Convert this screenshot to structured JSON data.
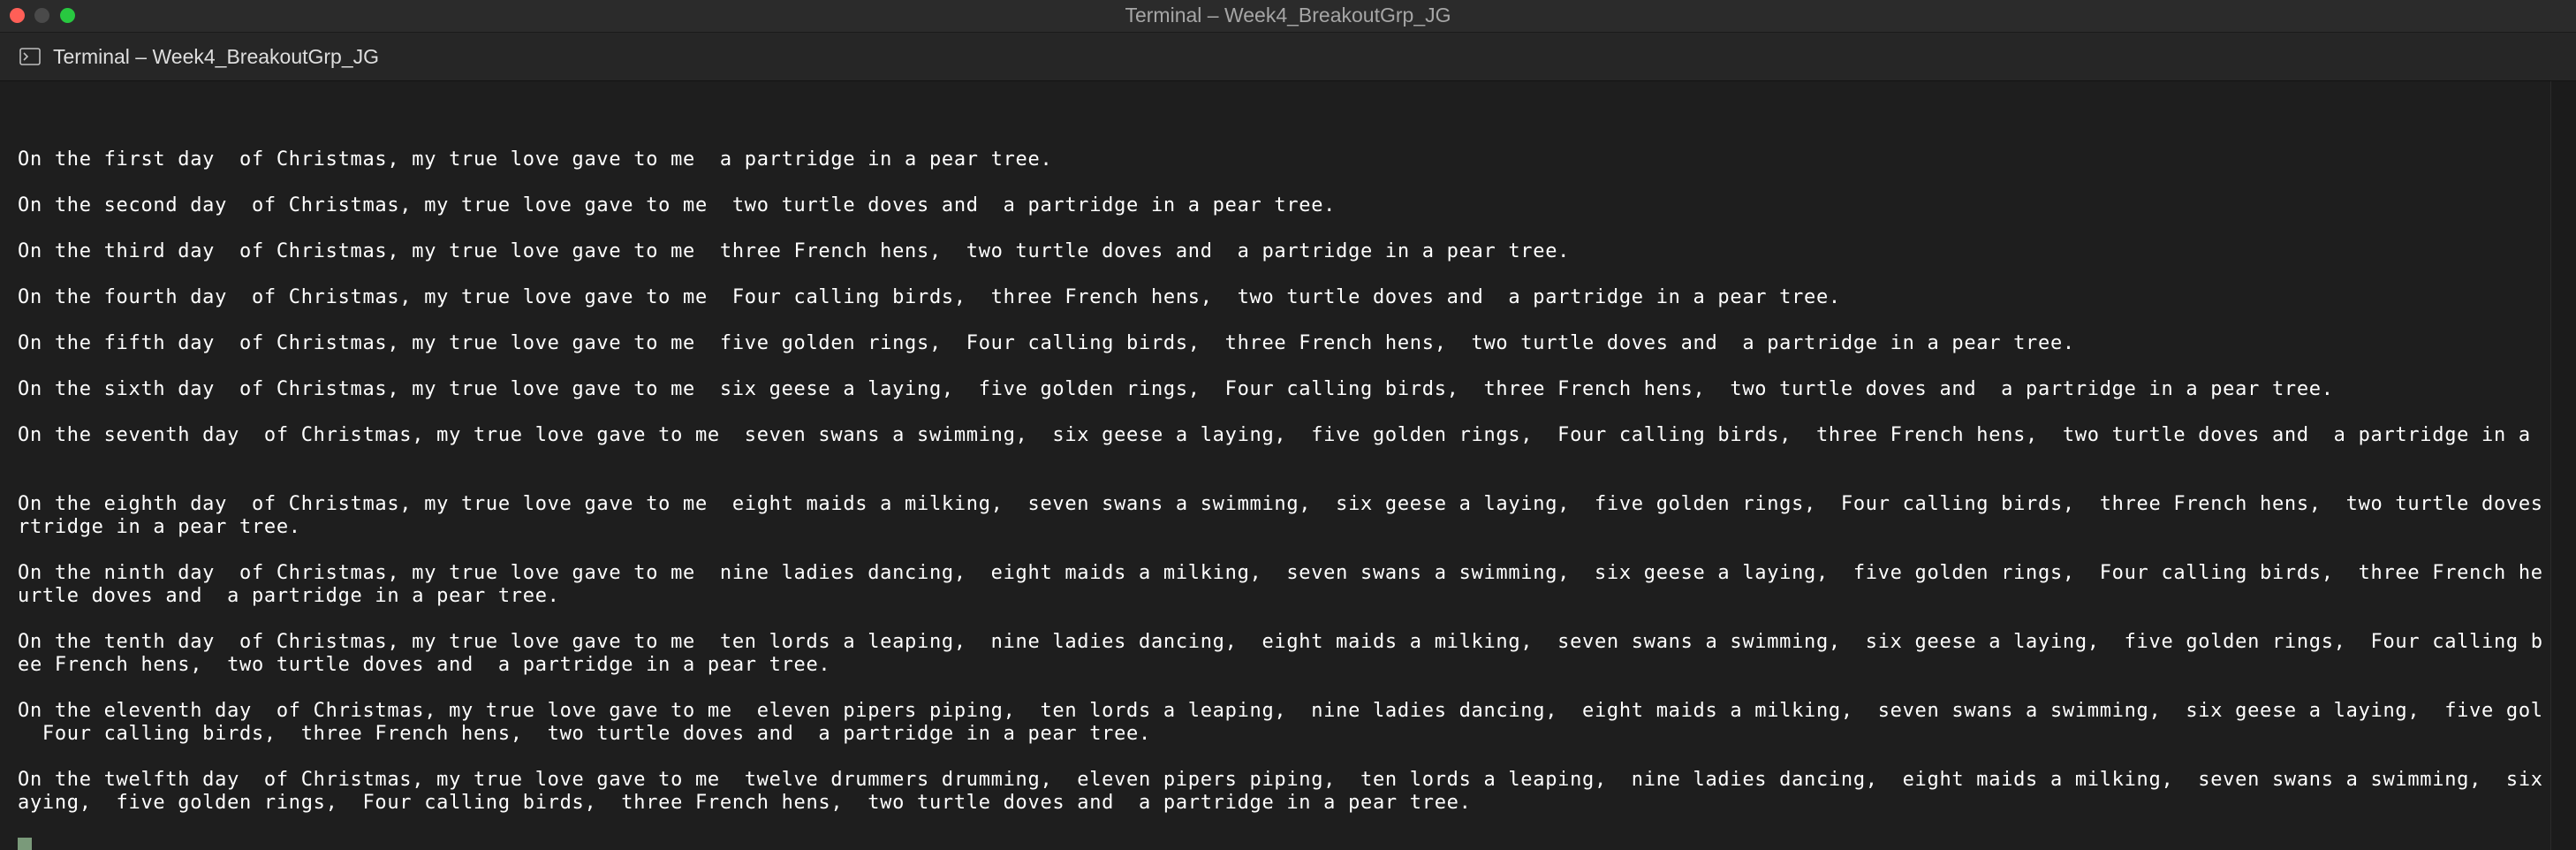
{
  "window": {
    "title": "Terminal – Week4_BreakoutGrp_JG",
    "tab_title": "Terminal – Week4_BreakoutGrp_JG"
  },
  "terminal": {
    "lines": [
      "",
      "On the first day  of Christmas, my true love gave to me  a partridge in a pear tree.",
      "",
      "On the second day  of Christmas, my true love gave to me  two turtle doves and  a partridge in a pear tree.",
      "",
      "On the third day  of Christmas, my true love gave to me  three French hens,  two turtle doves and  a partridge in a pear tree.",
      "",
      "On the fourth day  of Christmas, my true love gave to me  Four calling birds,  three French hens,  two turtle doves and  a partridge in a pear tree.",
      "",
      "On the fifth day  of Christmas, my true love gave to me  five golden rings,  Four calling birds,  three French hens,  two turtle doves and  a partridge in a pear tree.",
      "",
      "On the sixth day  of Christmas, my true love gave to me  six geese a laying,  five golden rings,  Four calling birds,  three French hens,  two turtle doves and  a partridge in a pear tree.",
      "",
      "On the seventh day  of Christmas, my true love gave to me  seven swans a swimming,  six geese a laying,  five golden rings,  Four calling birds,  three French hens,  two turtle doves and  a partridge in a pear tree.",
      "",
      "",
      "On the eighth day  of Christmas, my true love gave to me  eight maids a milking,  seven swans a swimming,  six geese a laying,  five golden rings,  Four calling birds,  three French hens,  two turtle doves and  a pa",
      "rtridge in a pear tree.",
      "",
      "On the ninth day  of Christmas, my true love gave to me  nine ladies dancing,  eight maids a milking,  seven swans a swimming,  six geese a laying,  five golden rings,  Four calling birds,  three French hens,  two t",
      "urtle doves and  a partridge in a pear tree.",
      "",
      "On the tenth day  of Christmas, my true love gave to me  ten lords a leaping,  nine ladies dancing,  eight maids a milking,  seven swans a swimming,  six geese a laying,  five golden rings,  Four calling birds,  thr",
      "ee French hens,  two turtle doves and  a partridge in a pear tree.",
      "",
      "On the eleventh day  of Christmas, my true love gave to me  eleven pipers piping,  ten lords a leaping,  nine ladies dancing,  eight maids a milking,  seven swans a swimming,  six geese a laying,  five golden rings,",
      "  Four calling birds,  three French hens,  two turtle doves and  a partridge in a pear tree.",
      "",
      "On the twelfth day  of Christmas, my true love gave to me  twelve drummers drumming,  eleven pipers piping,  ten lords a leaping,  nine ladies dancing,  eight maids a milking,  seven swans a swimming,  six geese a l",
      "aying,  five golden rings,  Four calling birds,  three French hens,  two turtle doves and  a partridge in a pear tree.",
      ""
    ]
  },
  "icons": {
    "window_close": "close-button-icon",
    "window_minimize": "minimize-button-icon",
    "window_zoom": "zoom-button-icon",
    "tab": "terminal-icon"
  },
  "colors": {
    "close": "#ff5f57",
    "zoom": "#28c840",
    "cursor": "#7a9a7a"
  }
}
